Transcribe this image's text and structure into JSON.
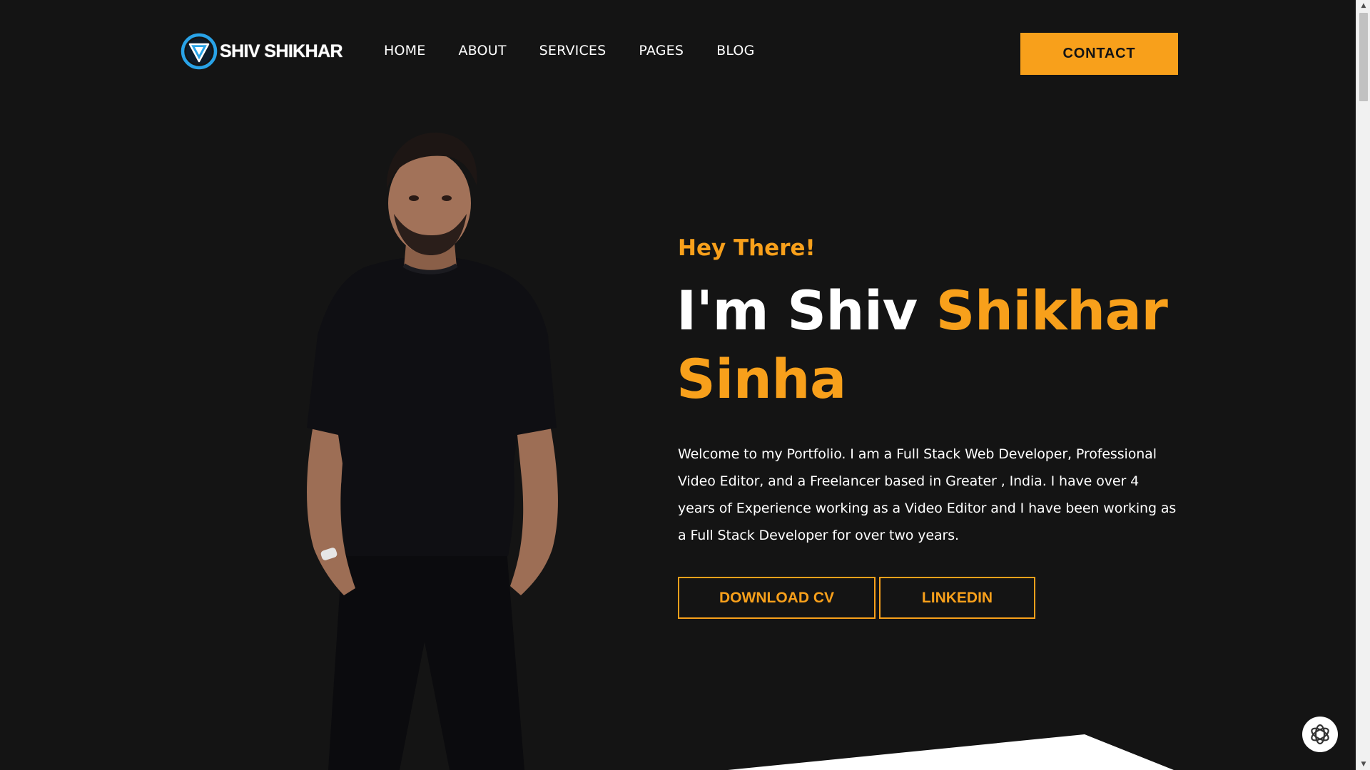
{
  "header": {
    "logo_text": "SHIV SHIKHAR",
    "nav": [
      "HOME",
      "ABOUT",
      "SERVICES",
      "PAGES",
      "BLOG"
    ],
    "contact_label": "CONTACT"
  },
  "hero": {
    "greeting": "Hey There!",
    "name_prefix": "I'm Shiv ",
    "name_highlight_1": "Shikhar",
    "name_highlight_2": "Sinha",
    "description": "Welcome to my Portfolio. I am a Full Stack Web Developer, Professional Video Editor, and a Freelancer based in Greater , India. I have over 4 years of Experience working as a Video Editor and I have been working as a Full Stack Developer for over two years.",
    "buttons": {
      "download_cv": "DOWNLOAD CV",
      "linkedin": "LINKEDIN"
    }
  },
  "colors": {
    "background": "#141414",
    "accent": "#f8a01b",
    "text": "#ffffff",
    "logo_blue": "#29a3e8"
  },
  "icons": {
    "logo": "logo-badge-icon",
    "chat": "chatgpt-icon",
    "scroll_up": "scroll-up-arrow-icon",
    "scroll_down": "scroll-down-arrow-icon"
  }
}
